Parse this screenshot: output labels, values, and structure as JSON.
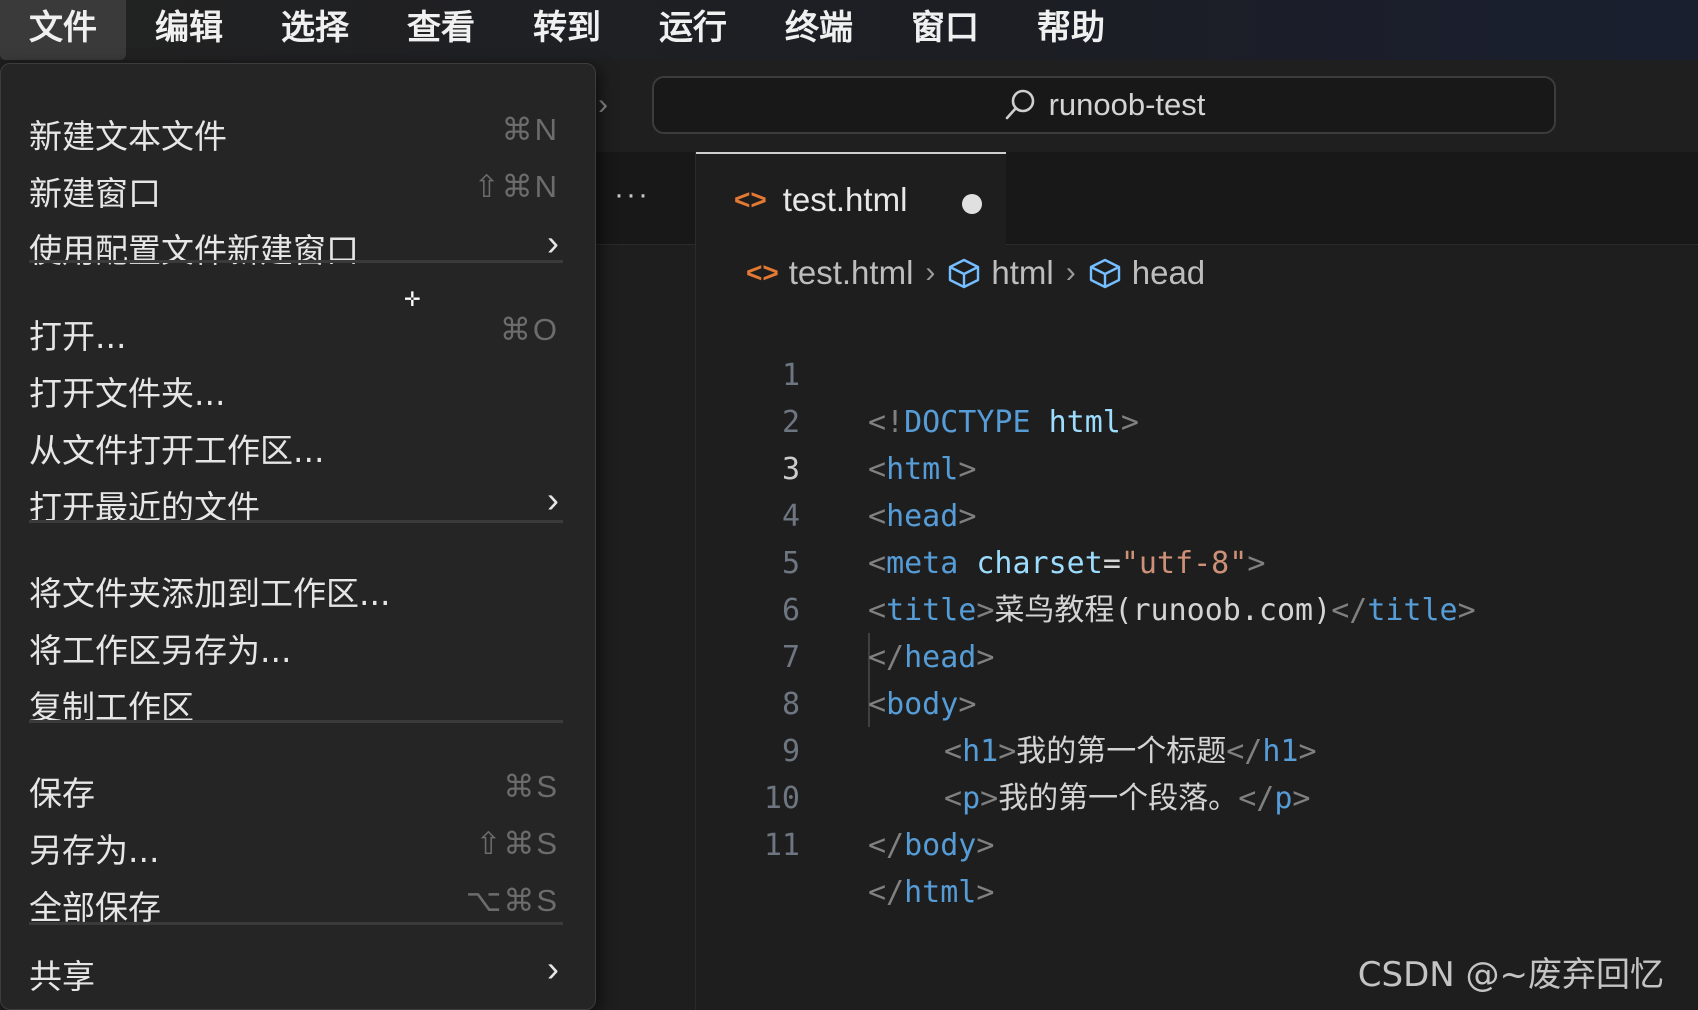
{
  "menubar": {
    "items": [
      "文件",
      "编辑",
      "选择",
      "查看",
      "转到",
      "运行",
      "终端",
      "窗口",
      "帮助"
    ],
    "active_index": 0
  },
  "search": {
    "text": "runoob-test",
    "icon": "search-icon"
  },
  "tab": {
    "title": "test.html",
    "icon": "html-file-icon",
    "dirty": true,
    "more": "···"
  },
  "breadcrumb": [
    "test.html",
    "html",
    "head"
  ],
  "editor": {
    "current_line": 3,
    "line_numbers": [
      "1",
      "2",
      "3",
      "4",
      "5",
      "6",
      "7",
      "8",
      "9",
      "10",
      "11"
    ]
  },
  "file_menu": {
    "items": [
      {
        "label": "新建文本文件",
        "shortcut": "⌘N"
      },
      {
        "label": "新建窗口",
        "shortcut": "⇧⌘N"
      },
      {
        "label": "使用配置文件新建窗口",
        "submenu": "›"
      },
      {
        "label": "打开...",
        "shortcut": "⌘O"
      },
      {
        "label": "打开文件夹..."
      },
      {
        "label": "从文件打开工作区..."
      },
      {
        "label": "打开最近的文件",
        "submenu": "›"
      },
      {
        "label": "将文件夹添加到工作区..."
      },
      {
        "label": "将工作区另存为..."
      },
      {
        "label": "复制工作区"
      },
      {
        "label": "保存",
        "shortcut": "⌘S"
      },
      {
        "label": "另存为...",
        "shortcut": "⇧⌘S"
      },
      {
        "label": "全部保存",
        "shortcut": "⌥⌘S"
      },
      {
        "label": "共享",
        "submenu": "›"
      }
    ]
  },
  "code": {
    "l1": [
      "<!",
      "DOCTYPE",
      " ",
      "html",
      ">"
    ],
    "l2": [
      "<",
      "html",
      ">"
    ],
    "l3": [
      "<",
      "head",
      ">"
    ],
    "l4": [
      "<",
      "meta",
      " ",
      "charset",
      "=",
      "\"utf-8\"",
      ">"
    ],
    "l5": [
      "<",
      "title",
      ">",
      "菜鸟教程(runoob.com)",
      "</",
      "title",
      ">"
    ],
    "l6": [
      "</",
      "head",
      ">"
    ],
    "l7": [
      "<",
      "body",
      ">"
    ],
    "l8": [
      "<",
      "h1",
      ">",
      "我的第一个标题",
      "</",
      "h1",
      ">"
    ],
    "l9": [
      "<",
      "p",
      ">",
      "我的第一个段落。",
      "</",
      "p",
      ">"
    ],
    "l10": [
      "</",
      "body",
      ">"
    ],
    "l11": [
      "</",
      "html",
      ">"
    ]
  },
  "watermark": "CSDN @~废弃回忆",
  "colors": {
    "tag": "#569cd6",
    "attr": "#9cdcfe",
    "string": "#ce9178",
    "punct": "#808080",
    "html_icon": "#e37933"
  }
}
